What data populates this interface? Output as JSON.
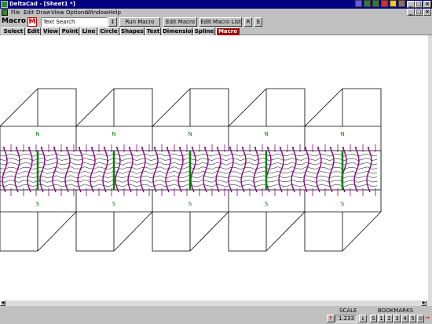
{
  "window": {
    "title": "DeltaCad - [Sheet1 *]"
  },
  "menu": {
    "items": [
      "File",
      "Edit",
      "Draw",
      "View",
      "Options",
      "Window",
      "Help"
    ]
  },
  "toolbar": {
    "mode_label": "Macro",
    "macro_icon_glyph": "M",
    "search_value": "Text Search",
    "updown_glyph": "↕",
    "run_label": "Run Macro",
    "edit_label": "Edit Macro",
    "editlist_label": "Edit Macro List",
    "r_label": "R",
    "e_label": "E"
  },
  "tabs": [
    {
      "label": "Select",
      "active": false
    },
    {
      "label": "Edit",
      "active": false
    },
    {
      "label": "View",
      "active": false
    },
    {
      "label": "Point",
      "active": false
    },
    {
      "label": "Line",
      "active": false
    },
    {
      "label": "Circle",
      "active": false
    },
    {
      "label": "Shapes",
      "active": false
    },
    {
      "label": "Text",
      "active": false
    },
    {
      "label": "Dimension",
      "active": false
    },
    {
      "label": "Spline",
      "active": false
    },
    {
      "label": "Macro",
      "active": true
    }
  ],
  "drawing": {
    "panel_count": 5,
    "north_label": "N",
    "south_label": "S",
    "colors": {
      "outline": "#000000",
      "label": "#008000",
      "wave": "#8b008b",
      "tick": "#8b008b",
      "center": "#008000"
    }
  },
  "statusbar": {
    "scale_caption": "SCALE",
    "scale_value": "1.233",
    "scale_up": "↑",
    "scale_down": "↓",
    "bookmarks_caption": "BOOKMARKS",
    "bookmarks": [
      "S",
      "1",
      "2",
      "3",
      "4",
      "5"
    ],
    "circle_glyph": "⊙",
    "arrow_glyph": "→"
  },
  "colors": {
    "titlebar": "#000080",
    "active_tab": "#a00000",
    "face": "#c0c0c0"
  }
}
